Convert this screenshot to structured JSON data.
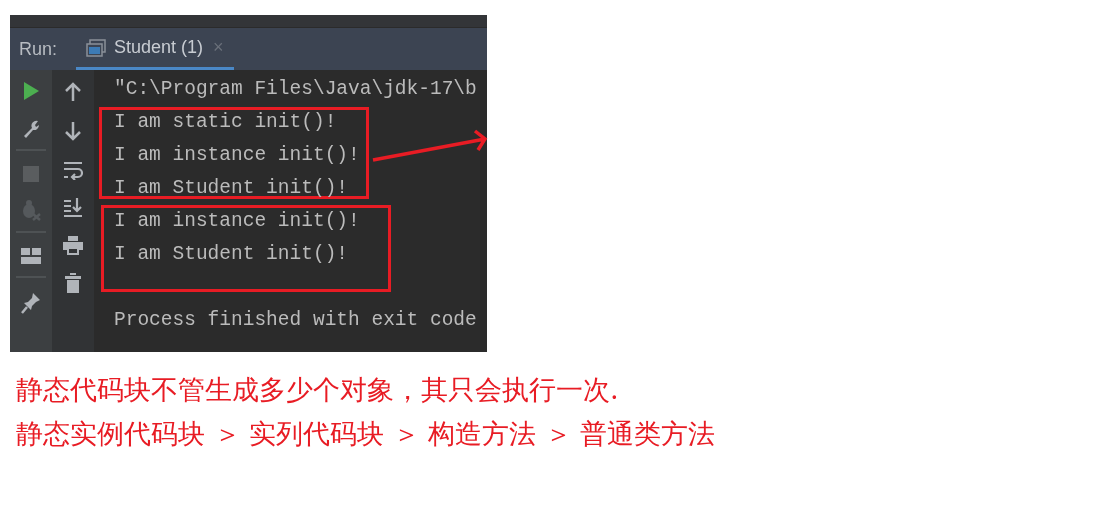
{
  "run_panel": {
    "label": "Run:",
    "tab": {
      "label": "Student (1)",
      "close": "×",
      "selected": true
    },
    "console": [
      {
        "lines": [
          "\"C:\\Program Files\\Java\\jdk-17\\b"
        ],
        "highlighted": false
      },
      {
        "lines": [
          "I am static init()!",
          "I am instance init()!",
          "I am Student init()!"
        ],
        "highlighted": true,
        "arrow": true
      },
      {
        "lines": [
          "I am instance init()!",
          "I am Student init()!"
        ],
        "highlighted": true,
        "arrow": false
      },
      {
        "lines": [
          "Process finished with exit code"
        ],
        "highlighted": false
      }
    ]
  },
  "notes": [
    "静态代码块不管生成多少个对象，其只会执行一次.",
    "静态实例代码块 ＞ 实列代码块 ＞ 构造方法 ＞ 普通类方法"
  ]
}
